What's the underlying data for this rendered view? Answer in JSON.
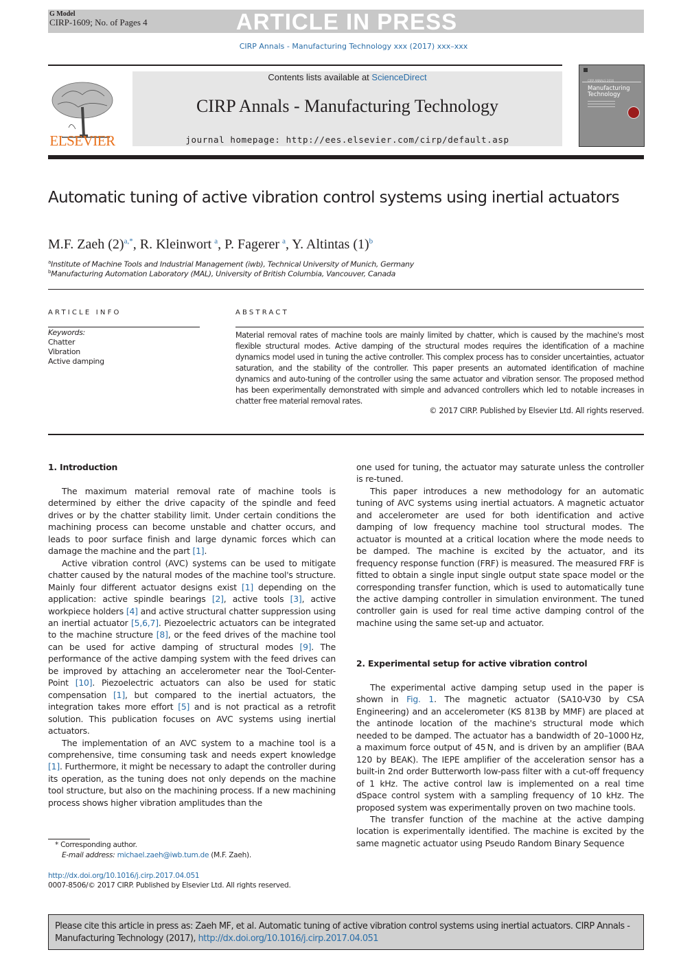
{
  "banner": {
    "model": "G Model",
    "id_pages": "CIRP-1609; No. of Pages 4",
    "status": "ARTICLE IN PRESS"
  },
  "running_head": "CIRP Annals - Manufacturing Technology xxx (2017) xxx–xxx",
  "journal_header": {
    "publisher_logo_text": "ELSEVIER",
    "contents_prefix": "Contents lists available at ",
    "contents_link": "ScienceDirect",
    "journal_name": "CIRP Annals - Manufacturing Technology",
    "homepage_label": "journal homepage: ",
    "homepage_url": "http://ees.elsevier.com/cirp/default.asp",
    "cover": {
      "series": "CIRP ANNALS 2016",
      "title_line1": "Manufacturing",
      "title_line2": "Technology"
    }
  },
  "article": {
    "title": "Automatic tuning of active vibration control systems using inertial actuators",
    "authors": [
      {
        "name": "M.F. Zaeh (2)",
        "sup": "a,*"
      },
      {
        "name": "R. Kleinwort",
        "sup": "a"
      },
      {
        "name": "P. Fagerer",
        "sup": "a"
      },
      {
        "name": "Y. Altintas (1)",
        "sup": "b"
      }
    ],
    "author_separator": ", ",
    "affiliations": [
      {
        "mark": "a",
        "text": "Institute of Machine Tools and Industrial Management (iwb), Technical University of Munich, Germany"
      },
      {
        "mark": "b",
        "text": "Manufacturing Automation Laboratory (MAL), University of British Columbia, Vancouver, Canada"
      }
    ]
  },
  "article_info": {
    "heading": "ARTICLE INFO",
    "keywords_label": "Keywords:",
    "keywords": [
      "Chatter",
      "Vibration",
      "Active damping"
    ]
  },
  "abstract": {
    "heading": "ABSTRACT",
    "text": "Material removal rates of machine tools are mainly limited by chatter, which is caused by the machine's most flexible structural modes. Active damping of the structural modes requires the identification of a machine dynamics model used in tuning the active controller. This complex process has to consider uncertainties, actuator saturation, and the stability of the controller. This paper presents an automated identification of machine dynamics and auto-tuning of the controller using the same actuator and vibration sensor. The proposed method has been experimentally demonstrated with simple and advanced controllers which led to notable increases in chatter free material removal rates.",
    "copyright": "© 2017 CIRP. Published by Elsevier Ltd. All rights reserved."
  },
  "sections": {
    "s1_heading": "1.  Introduction",
    "s1_p1": [
      "The maximum material removal rate of machine tools is determined by either the drive capacity of the spindle and feed drives or by the chatter stability limit. Under certain conditions the machining process can become unstable and chatter occurs, and leads to poor surface finish and large dynamic forces which can damage the machine and the part ",
      "[1]",
      "."
    ],
    "s1_p2": [
      "Active vibration control (AVC) systems can be used to mitigate chatter caused by the natural modes of the machine tool's structure. Mainly four different actuator designs exist ",
      "[1]",
      " depending on the application: active spindle bearings ",
      "[2]",
      ", active tools ",
      "[3]",
      ", active workpiece holders ",
      "[4]",
      " and active structural chatter suppression using an inertial actuator ",
      "[5,6,7]",
      ". Piezoelectric actuators can be integrated to the machine structure ",
      "[8]",
      ", or the feed drives of the machine tool can be used for active damping of structural modes ",
      "[9]",
      ". The performance of the active damping system with the feed drives can be improved by attaching an accelerometer near the Tool-Center-Point ",
      "[10]",
      ". Piezoelectric actuators can also be used for static compensation ",
      "[1]",
      ", but compared to the inertial actuators, the integration takes more effort ",
      "[5]",
      " and is not practical as a retrofit solution. This publication focuses on AVC systems using inertial actuators."
    ],
    "s1_p3": [
      "The implementation of an AVC system to a machine tool is a comprehensive, time consuming task and needs expert knowledge ",
      "[1]",
      ". Furthermore, it might be necessary to adapt the controller during its operation, as the tuning does not only depends on the machine tool structure, but also on the machining process. If a new machining process shows higher vibration amplitudes than the"
    ],
    "s1_p3_cont": "one used for tuning, the actuator may saturate unless the controller is re-tuned.",
    "s1_p4": "This paper introduces a new methodology for an automatic tuning of AVC systems using inertial actuators. A magnetic actuator and accelerometer are used for both identification and active damping of low frequency machine tool structural modes. The actuator is mounted at a critical location where the mode needs to be damped. The machine is excited by the actuator, and its frequency response function (FRF) is measured. The measured FRF is fitted to obtain a single input single output state space model or the corresponding transfer function, which is used to automatically tune the active damping controller in simulation environment. The tuned controller gain is used for real time active damping control of the machine using the same set-up and actuator.",
    "s2_heading": "2.  Experimental setup for active vibration control",
    "s2_p1": [
      "The experimental active damping setup used in the paper is shown in ",
      "Fig. 1",
      ". The magnetic actuator (SA10-V30 by CSA Engineering) and an accelerometer (KS 813B by MMF) are placed at the antinode location of the machine's structural mode which needed to be damped. The actuator has a bandwidth of 20–1000 Hz, a maximum force output of 45 N, and is driven by an amplifier (BAA 120 by BEAK). The IEPE amplifier of the acceleration sensor has a built-in 2nd order Butterworth low-pass filter with a cut-off frequency of 1 kHz. The active control law is implemented on a real time dSpace control system with a sampling frequency of 10 kHz. The proposed system was experimentally proven on two machine tools."
    ],
    "s2_p2": "The transfer function of the machine at the active damping location is experimentally identified. The machine is excited by the same magnetic actuator using Pseudo Random Binary Sequence"
  },
  "footnotes": {
    "corresponding": "*  Corresponding author.",
    "email_label": "E-mail address: ",
    "email": "michael.zaeh@iwb.tum.de",
    "email_suffix": " (M.F. Zaeh).",
    "doi": "http://dx.doi.org/10.1016/j.cirp.2017.04.051",
    "issn_copyright": "0007-8506/© 2017 CIRP. Published by Elsevier Ltd. All rights reserved."
  },
  "cite_box": {
    "text": "Please cite this article in press as: Zaeh MF, et al. Automatic tuning of active vibration control systems using inertial actuators. CIRP Annals - Manufacturing Technology (2017), ",
    "link": "http://dx.doi.org/10.1016/j.cirp.2017.04.051"
  },
  "colors": {
    "link": "#2a6ea8",
    "elsevier_orange": "#e9711c",
    "banner_gray": "#c8c8c8",
    "journal_box": "#e6e6e6"
  }
}
